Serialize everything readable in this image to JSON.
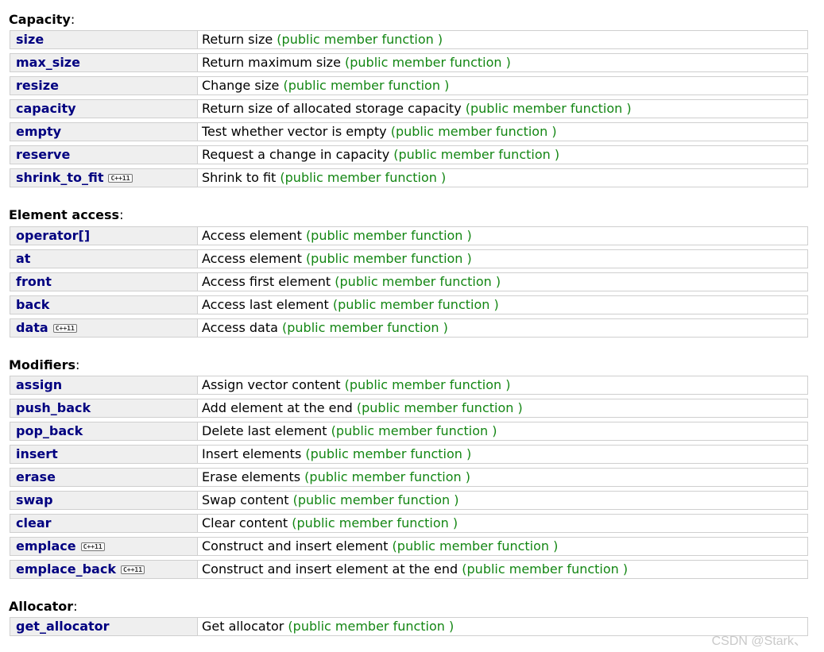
{
  "sections": [
    {
      "title": "Capacity",
      "rows": [
        {
          "name": "size",
          "desc": "Return size",
          "kind": "(public member function )",
          "badge": ""
        },
        {
          "name": "max_size",
          "desc": "Return maximum size",
          "kind": "(public member function )",
          "badge": ""
        },
        {
          "name": "resize",
          "desc": "Change size",
          "kind": "(public member function )",
          "badge": ""
        },
        {
          "name": "capacity",
          "desc": "Return size of allocated storage capacity",
          "kind": "(public member function )",
          "badge": ""
        },
        {
          "name": "empty",
          "desc": "Test whether vector is empty",
          "kind": "(public member function )",
          "badge": ""
        },
        {
          "name": "reserve",
          "desc": "Request a change in capacity",
          "kind": "(public member function )",
          "badge": ""
        },
        {
          "name": "shrink_to_fit",
          "desc": "Shrink to fit",
          "kind": "(public member function )",
          "badge": "C++11"
        }
      ]
    },
    {
      "title": "Element access",
      "rows": [
        {
          "name": "operator[]",
          "desc": "Access element",
          "kind": "(public member function )",
          "badge": ""
        },
        {
          "name": "at",
          "desc": "Access element",
          "kind": "(public member function )",
          "badge": ""
        },
        {
          "name": "front",
          "desc": "Access first element",
          "kind": "(public member function )",
          "badge": ""
        },
        {
          "name": "back",
          "desc": "Access last element",
          "kind": "(public member function )",
          "badge": ""
        },
        {
          "name": "data",
          "desc": "Access data",
          "kind": "(public member function )",
          "badge": "C++11"
        }
      ]
    },
    {
      "title": "Modifiers",
      "rows": [
        {
          "name": "assign",
          "desc": "Assign vector content",
          "kind": "(public member function )",
          "badge": ""
        },
        {
          "name": "push_back",
          "desc": "Add element at the end",
          "kind": "(public member function )",
          "badge": ""
        },
        {
          "name": "pop_back",
          "desc": "Delete last element",
          "kind": "(public member function )",
          "badge": ""
        },
        {
          "name": "insert",
          "desc": "Insert elements",
          "kind": "(public member function )",
          "badge": ""
        },
        {
          "name": "erase",
          "desc": "Erase elements",
          "kind": "(public member function )",
          "badge": ""
        },
        {
          "name": "swap",
          "desc": "Swap content",
          "kind": "(public member function )",
          "badge": ""
        },
        {
          "name": "clear",
          "desc": "Clear content",
          "kind": "(public member function )",
          "badge": ""
        },
        {
          "name": "emplace",
          "desc": "Construct and insert element",
          "kind": "(public member function )",
          "badge": "C++11"
        },
        {
          "name": "emplace_back",
          "desc": "Construct and insert element at the end",
          "kind": "(public member function )",
          "badge": "C++11"
        }
      ]
    },
    {
      "title": "Allocator",
      "rows": [
        {
          "name": "get_allocator",
          "desc": "Get allocator",
          "kind": "(public member function )",
          "badge": ""
        }
      ]
    }
  ],
  "colors": {
    "member_name": "#000080",
    "kind_text": "#138613",
    "name_cell_bg": "#efefef",
    "border": "#cfcfcf",
    "watermark": "#c9c9c9"
  },
  "watermark": "CSDN @Stark、"
}
